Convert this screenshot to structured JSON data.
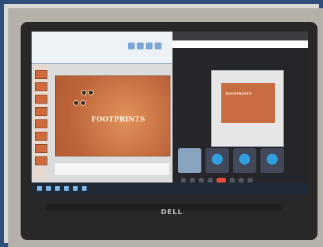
{
  "photo": {
    "brand": "DELL",
    "slide_title": "FOOTPRINTS"
  }
}
